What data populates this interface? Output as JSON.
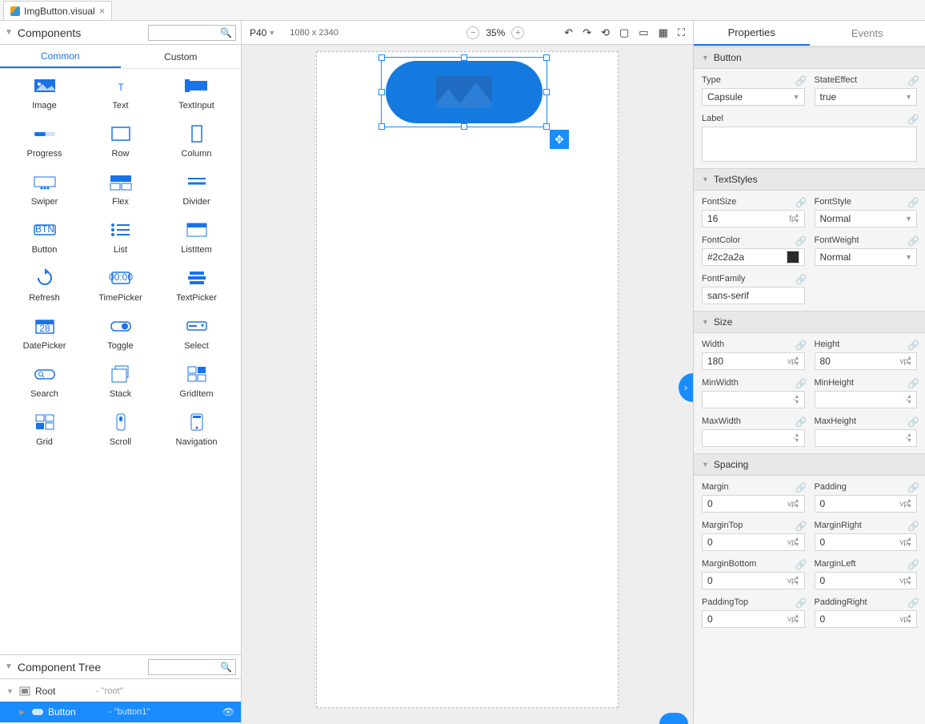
{
  "tab": {
    "title": "ImgButton.visual"
  },
  "panels": {
    "components_title": "Components",
    "subtabs": {
      "common": "Common",
      "custom": "Custom"
    },
    "tree_title": "Component Tree"
  },
  "palette": [
    {
      "name": "Image"
    },
    {
      "name": "Text"
    },
    {
      "name": "TextInput"
    },
    {
      "name": "Progress"
    },
    {
      "name": "Row"
    },
    {
      "name": "Column"
    },
    {
      "name": "Swiper"
    },
    {
      "name": "Flex"
    },
    {
      "name": "Divider"
    },
    {
      "name": "Button"
    },
    {
      "name": "List"
    },
    {
      "name": "ListItem"
    },
    {
      "name": "Refresh"
    },
    {
      "name": "TimePicker"
    },
    {
      "name": "TextPicker"
    },
    {
      "name": "DatePicker"
    },
    {
      "name": "Toggle"
    },
    {
      "name": "Select"
    },
    {
      "name": "Search"
    },
    {
      "name": "Stack"
    },
    {
      "name": "GridItem"
    },
    {
      "name": "Grid"
    },
    {
      "name": "Scroll"
    },
    {
      "name": "Navigation"
    }
  ],
  "tree": {
    "root": {
      "label": "Root",
      "inst": "- \"root\""
    },
    "button": {
      "label": "Button",
      "inst": "- \"button1\""
    }
  },
  "toolbar": {
    "device": "P40",
    "dims": "1080 x 2340",
    "zoom": "35%"
  },
  "rtabs": {
    "properties": "Properties",
    "events": "Events"
  },
  "properties": {
    "button": {
      "title": "Button",
      "type_lbl": "Type",
      "type_val": "Capsule",
      "state_lbl": "StateEffect",
      "state_val": "true",
      "label_lbl": "Label"
    },
    "text": {
      "title": "TextStyles",
      "fontsize_lbl": "FontSize",
      "fontsize_val": "16",
      "fontsize_unit": "fp",
      "fontstyle_lbl": "FontStyle",
      "fontstyle_val": "Normal",
      "fontcolor_lbl": "FontColor",
      "fontcolor_val": "#2c2a2a",
      "fontweight_lbl": "FontWeight",
      "fontweight_val": "Normal",
      "fontfamily_lbl": "FontFamily",
      "fontfamily_val": "sans-serif"
    },
    "size": {
      "title": "Size",
      "width_lbl": "Width",
      "width_val": "180",
      "height_lbl": "Height",
      "height_val": "80",
      "minw_lbl": "MinWidth",
      "minw_val": "-",
      "minh_lbl": "MinHeight",
      "minh_val": "-",
      "maxw_lbl": "MaxWidth",
      "maxw_val": "-",
      "maxh_lbl": "MaxHeight",
      "maxh_val": "-",
      "unit": "vp"
    },
    "spacing": {
      "title": "Spacing",
      "margin_lbl": "Margin",
      "margin_val": "0",
      "padding_lbl": "Padding",
      "padding_val": "0",
      "mtop_lbl": "MarginTop",
      "mtop_val": "0",
      "mright_lbl": "MarginRight",
      "mright_val": "0",
      "mbottom_lbl": "MarginBottom",
      "mbottom_val": "0",
      "mleft_lbl": "MarginLeft",
      "mleft_val": "0",
      "ptop_lbl": "PaddingTop",
      "ptop_val": "0",
      "pright_lbl": "PaddingRight",
      "pright_val": "0",
      "unit": "vp"
    }
  }
}
